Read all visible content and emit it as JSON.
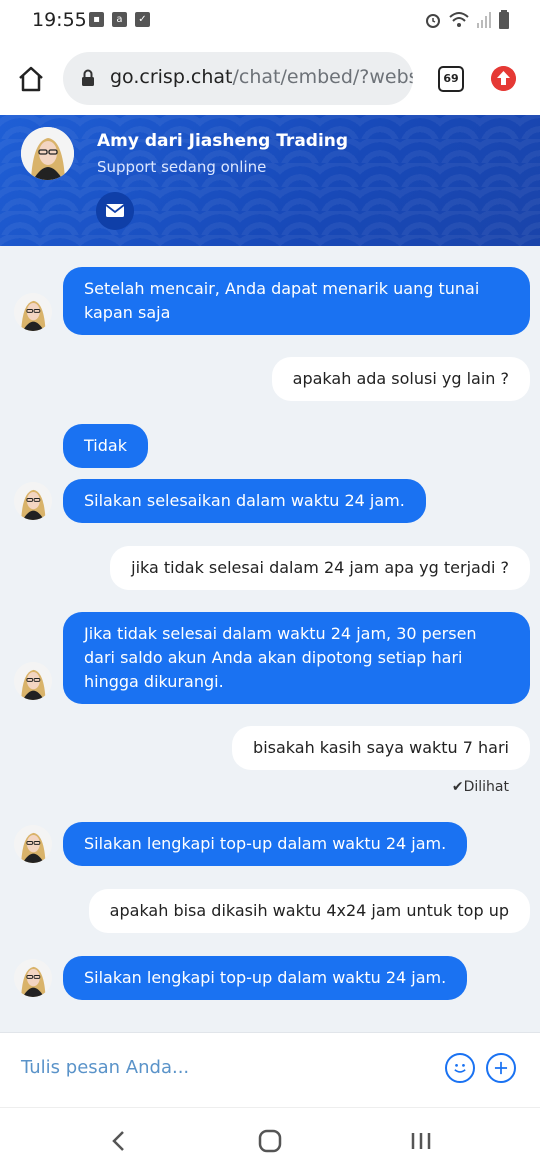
{
  "status_bar": {
    "time": "19:55",
    "left_icons": [
      "image-icon",
      "notification-icon",
      "check-icon"
    ],
    "right_icons": [
      "alarm-icon",
      "wifi-icon",
      "signal-icon",
      "battery-icon"
    ]
  },
  "browser": {
    "url_domain": "go.crisp.chat",
    "url_path": "/chat/embed/?website",
    "tab_count": "69"
  },
  "chat_header": {
    "agent_name": "Amy dari Jiasheng Trading",
    "status": "Support sedang online"
  },
  "messages": [
    {
      "from": "agent",
      "text": "Setelah mencair, Anda dapat menarik uang tunai kapan saja"
    },
    {
      "from": "user",
      "text": "apakah ada solusi yg lain ?"
    },
    {
      "from": "agent",
      "text": "Tidak"
    },
    {
      "from": "agent",
      "text": "Silakan selesaikan dalam waktu 24 jam."
    },
    {
      "from": "user",
      "text": "jika tidak selesai dalam 24 jam apa yg terjadi ?"
    },
    {
      "from": "agent",
      "text": "Jika tidak selesai dalam waktu 24 jam, 30 persen dari saldo akun Anda akan dipotong setiap hari hingga dikurangi."
    },
    {
      "from": "user",
      "text": "bisakah kasih saya waktu 7 hari"
    },
    {
      "from": "agent",
      "text": "Silakan lengkapi top-up dalam waktu 24 jam."
    },
    {
      "from": "user",
      "text": "apakah bisa dikasih waktu 4x24 jam untuk top up"
    },
    {
      "from": "agent",
      "text": "Silakan lengkapi top-up dalam waktu 24 jam."
    }
  ],
  "seen_label": "Dilihat",
  "composer": {
    "placeholder": "Tulis pesan Anda..."
  },
  "colors": {
    "header_blue": "#1f5fd6",
    "agent_bubble": "#1a72f2",
    "chat_background": "#eef2f6"
  }
}
